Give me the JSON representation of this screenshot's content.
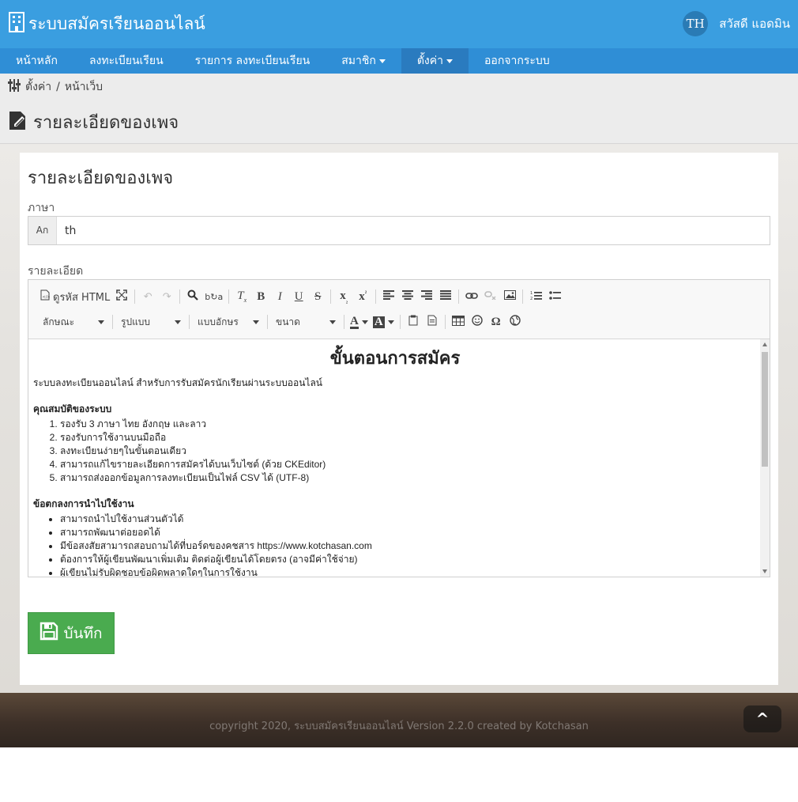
{
  "header": {
    "title": "ระบบสมัครเรียนออนไลน์",
    "avatar_initials": "TH",
    "user_greeting": "สวัสดี แอดมิน"
  },
  "nav": {
    "items": [
      "หน้าหลัก",
      "ลงทะเบียนเรียน",
      "รายการ ลงทะเบียนเรียน",
      "สมาชิก",
      "ตั้งค่า",
      "ออกจากระบบ"
    ],
    "active": "ตั้งค่า"
  },
  "breadcrumb": {
    "parent": "ตั้งค่า",
    "separator": "/",
    "current": "หน้าเว็บ"
  },
  "page_title": "รายละเอียดของเพจ",
  "form": {
    "card_title": "รายละเอียดของเพจ",
    "language_label": "ภาษา",
    "language_addon": "Aก",
    "language_value": "th",
    "detail_label": "รายละเอียด",
    "save_label": "บันทึก"
  },
  "editor": {
    "source_label": "ดูรหัส HTML",
    "combos": [
      "ลักษณะ",
      "รูปแบบ",
      "แบบอักษร",
      "ขนาด"
    ],
    "content": {
      "heading": "ขั้นตอนการสมัคร",
      "intro": "ระบบลงทะเบียนออนไลน์ สำหรับการรับสมัครนักเรียนผ่านระบบออนไลน์",
      "features_title": "คุณสมบัติของระบบ",
      "features": [
        "รองรับ 3 ภาษา ไทย อังกฤษ และลาว",
        "รองรับการใช้งานบนมือถือ",
        "ลงทะเบียนง่ายๆในขั้นตอนเดียว",
        "สามารถแก้ไขรายละเอียดการสมัครได้บนเว็บไซต์ (ด้วย CKEditor)",
        "สามารถส่งออกข้อมูลการลงทะเบียนเป็นไฟล์ CSV ได้ (UTF-8)"
      ],
      "terms_title": "ข้อตกลงการนำไปใช้งาน",
      "terms": [
        "สามารถนำไปใช้งานส่วนตัวได้",
        "สามารถพัฒนาต่อยอดได้",
        "มีข้อสงสัยสามารถสอบถามได้ที่บอร์ดของคชสาร https://www.kotchasan.com",
        "ต้องการให้ผู้เขียนพัฒนาเพิ่มเติม ติดต่อผู้เขียนได้โดยตรง (อาจมีค่าใช้จ่าย)",
        "ผู้เขียนไม่รับผิดชอบข้อผิดพลาดใดๆในการใช้งาน"
      ]
    }
  },
  "footer": {
    "copyright": "copyright 2020, ระบบสมัครเรียนออนไลน์ Version 2.2.0 created by Kotchasan",
    "totop_label": "^"
  }
}
